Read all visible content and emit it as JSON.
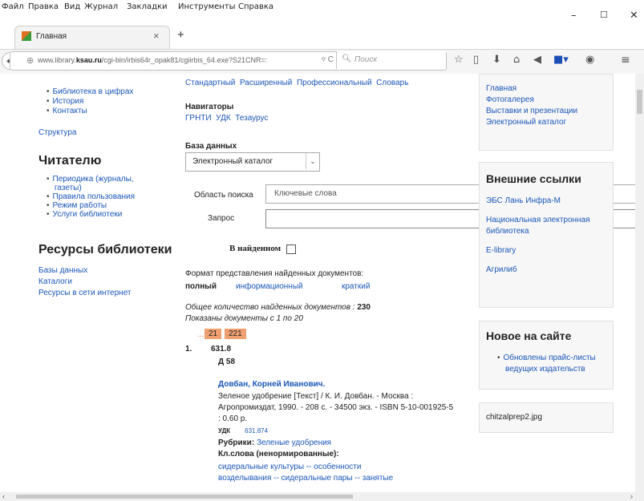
{
  "menu": [
    "Файл",
    "Правка",
    "Вид",
    "Журнал",
    "Закладки",
    "Инструменты",
    "Справка"
  ],
  "window_controls": [
    "–",
    "☐",
    "✕"
  ],
  "tab": {
    "title": "Главная",
    "close": "×",
    "new": "+"
  },
  "url": {
    "prefix": "www.library.",
    "domain": "ksau.ru",
    "path": "/cgi-bin/irbis64r_opak81/cgiirbis_64.exe?S21CNR=:",
    "search_placeholder": "Поиск"
  },
  "left": {
    "items_top": [
      "Библиотека в цифрах",
      "История",
      "Контакты"
    ],
    "structure": "Структура",
    "reader_title": "Читателю",
    "reader_items": [
      "Периодика (журналы,",
      "газеты)",
      "Правила пользования",
      "Режим работы",
      "Услуги библиотеки"
    ],
    "resources_title": "Ресурсы библиотеки",
    "resources": [
      "Базы данных",
      "Каталоги",
      "Ресурсы в сети интернет"
    ]
  },
  "center": {
    "modes": "Стандартный  Расширенный  Профессиональный  Словарь",
    "navigators_label": "Навигаторы",
    "navigators": "ГРНТИ  УДК  Тезаурус",
    "db_label": "База данных",
    "db_value": "Электронный каталог",
    "area_label": "Область поиска",
    "area_value": "Ключевые слова",
    "query_label": "Запрос",
    "in_found": "В найденном",
    "format_label": "Формат представления найденных документов:",
    "formats": [
      "полный",
      "информационный",
      "краткий"
    ],
    "total_text": "Общее количество найденных документов",
    "total": "230",
    "shown": "Показаны документы с 1 по 20",
    "pager_prefix": "...",
    "pages": [
      "21",
      "221"
    ],
    "rec_num": "1.",
    "rec_class": "631.8",
    "rec_code": "Д 58",
    "author": "Довбан, Корней Иванович.",
    "desc1": "Зеленое удобрение [Текст] / К. И. Довбан. - Москва :",
    "desc2": "Агропромиздат, 1990. - 208 с. - 34500 экз. - ISBN 5-10-001925-5",
    "desc3": ": 0.60 р.",
    "udk_label": "УДК",
    "udk": "631.874",
    "rubrics_label": "Рубрики:",
    "rubrics": "Зеленые удобрения",
    "kw_label": "Кл.слова (ненормированные):",
    "kw1": "сидеральные культуры -- особенности",
    "kw2": "возделывания -- сидеральные пары -- занятые"
  },
  "right": {
    "links_top": [
      "Главная",
      "Фотогалерея",
      "Выставки и презентации",
      "Электронный каталог"
    ],
    "ext_title": "Внешние ссылки",
    "ext_links": [
      "ЭБС Лань Инфра-М",
      "Национальная электронная",
      "библиотека",
      "E-library",
      "Агрилиб"
    ],
    "new_title": "Новое на сайте",
    "new_items": [
      "Обновлены прайс-листы",
      "ведущих издательств"
    ],
    "image_name": "chitzalprep2.jpg"
  }
}
